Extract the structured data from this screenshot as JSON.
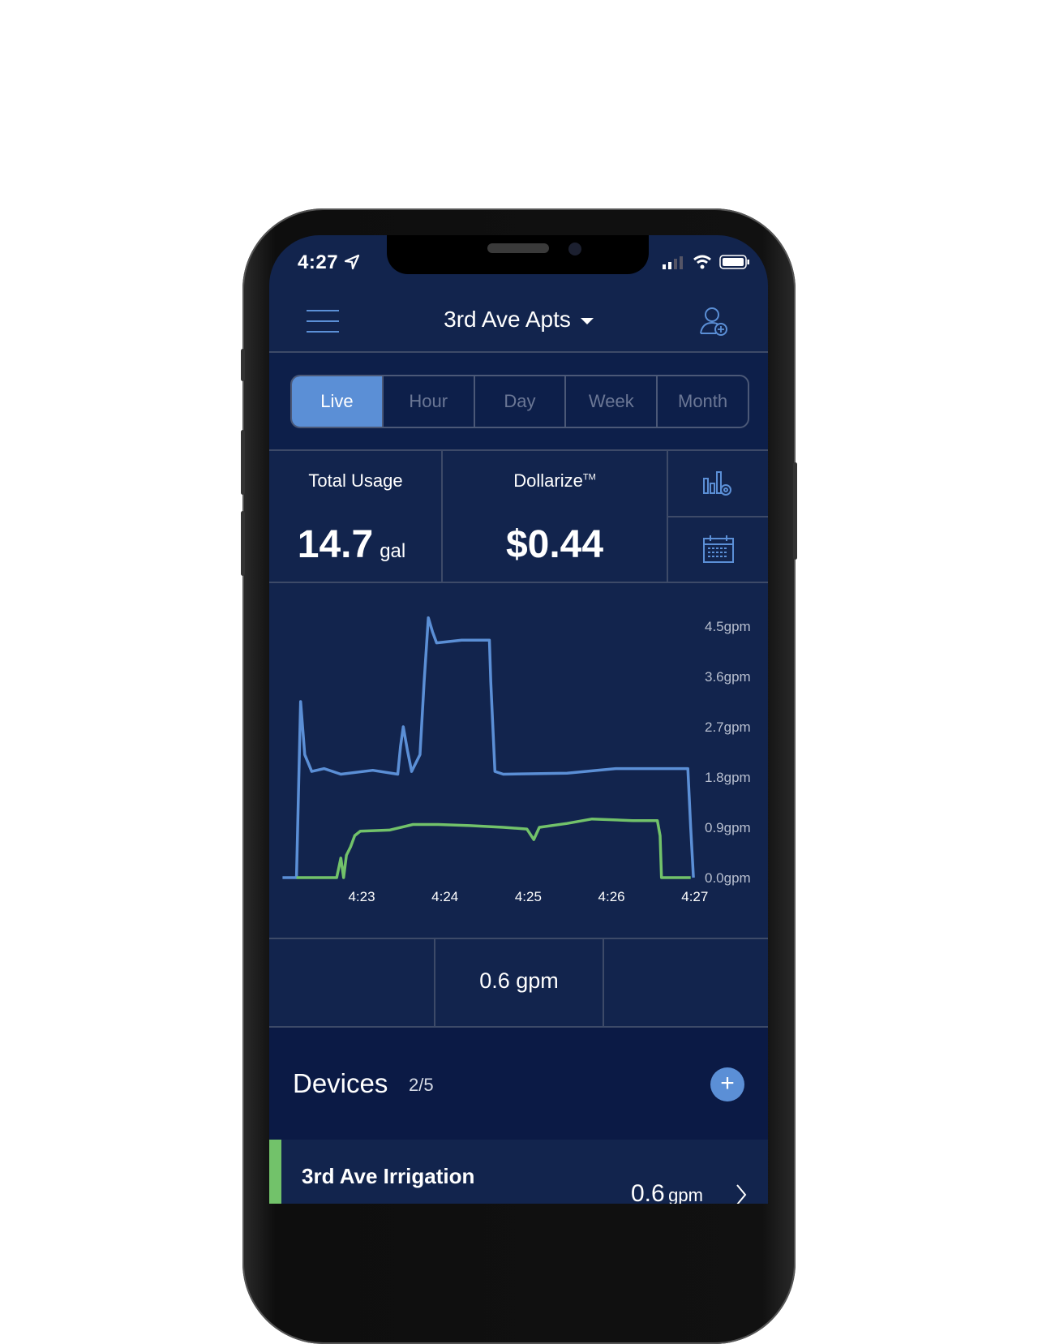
{
  "status_bar": {
    "time": "4:27",
    "location_icon": "location-arrow-icon",
    "signal_icon": "cellular-signal-icon",
    "wifi_icon": "wifi-icon",
    "battery_icon": "battery-icon"
  },
  "header": {
    "title": "3rd Ave Apts",
    "menu_icon": "hamburger-menu-icon",
    "add_user_icon": "add-user-icon"
  },
  "tabs": [
    {
      "label": "Live",
      "active": true
    },
    {
      "label": "Hour",
      "active": false
    },
    {
      "label": "Day",
      "active": false
    },
    {
      "label": "Week",
      "active": false
    },
    {
      "label": "Month",
      "active": false
    }
  ],
  "stats": {
    "total_usage_label": "Total Usage",
    "total_usage_value": "14.7",
    "total_usage_unit": "gal",
    "dollarize_label": "Dollarize",
    "dollarize_tm": "TM",
    "dollarize_value": "$0.44",
    "chart_settings_icon": "chart-settings-icon",
    "calendar_icon": "calendar-icon"
  },
  "chart_data": {
    "type": "line",
    "y_ticks": [
      "0.0gpm",
      "0.9gpm",
      "1.8gpm",
      "2.7gpm",
      "3.6gpm",
      "4.5gpm"
    ],
    "y_tick_values": [
      0,
      0.9,
      1.8,
      2.7,
      3.6,
      4.5
    ],
    "x_ticks": [
      "4:23",
      "4:24",
      "4:25",
      "4:26",
      "4:27"
    ],
    "x_range": [
      "4:22:03",
      "4:27:00"
    ],
    "ylim": [
      0,
      4.5
    ],
    "grid": false,
    "y_axis_position": "right",
    "series": [
      {
        "color": "#5b8fd6",
        "points": [
          [
            "4:22:03",
            0
          ],
          [
            "4:22:13",
            0
          ],
          [
            "4:22:16",
            3.15
          ],
          [
            "4:22:19",
            2.2
          ],
          [
            "4:22:24",
            1.9
          ],
          [
            "4:22:33",
            1.95
          ],
          [
            "4:22:45",
            1.85
          ],
          [
            "4:23:08",
            1.92
          ],
          [
            "4:23:26",
            1.85
          ],
          [
            "4:23:28",
            2.35
          ],
          [
            "4:23:30",
            2.7
          ],
          [
            "4:23:33",
            2.27
          ],
          [
            "4:23:36",
            1.9
          ],
          [
            "4:23:42",
            2.2
          ],
          [
            "4:23:45",
            3.5
          ],
          [
            "4:23:48",
            4.65
          ],
          [
            "4:23:51",
            4.4
          ],
          [
            "4:23:54",
            4.2
          ],
          [
            "4:24:12",
            4.25
          ],
          [
            "4:24:32",
            4.25
          ],
          [
            "4:24:33",
            3.5
          ],
          [
            "4:24:36",
            1.9
          ],
          [
            "4:24:42",
            1.85
          ],
          [
            "4:25:28",
            1.87
          ],
          [
            "4:26:03",
            1.95
          ],
          [
            "4:26:38",
            1.95
          ],
          [
            "4:26:55",
            1.95
          ],
          [
            "4:26:57",
            0.9
          ],
          [
            "4:26:59",
            0
          ]
        ]
      },
      {
        "color": "#72c26a",
        "points": [
          [
            "4:22:13",
            0
          ],
          [
            "4:22:42",
            0
          ],
          [
            "4:22:45",
            0.35
          ],
          [
            "4:22:47",
            0
          ],
          [
            "4:22:49",
            0.4
          ],
          [
            "4:22:52",
            0.55
          ],
          [
            "4:22:55",
            0.75
          ],
          [
            "4:22:59",
            0.83
          ],
          [
            "4:23:20",
            0.85
          ],
          [
            "4:23:37",
            0.95
          ],
          [
            "4:23:55",
            0.95
          ],
          [
            "4:24:18",
            0.93
          ],
          [
            "4:24:42",
            0.9
          ],
          [
            "4:24:59",
            0.87
          ],
          [
            "4:25:04",
            0.68
          ],
          [
            "4:25:08",
            0.9
          ],
          [
            "4:25:28",
            0.97
          ],
          [
            "4:25:46",
            1.05
          ],
          [
            "4:26:15",
            1.02
          ],
          [
            "4:26:33",
            1.02
          ],
          [
            "4:26:35",
            0.75
          ],
          [
            "4:26:36",
            0
          ],
          [
            "4:26:57",
            0
          ]
        ]
      }
    ]
  },
  "readout": {
    "value": "0.6 gpm"
  },
  "devices": {
    "title": "Devices",
    "count": "2/5",
    "add_icon": "plus-icon",
    "items": [
      {
        "name": "3rd Ave Irrigation",
        "value": "0.6",
        "unit": "gpm",
        "status_color": "#72c26a",
        "chevron_icon": "chevron-right-icon"
      }
    ]
  }
}
